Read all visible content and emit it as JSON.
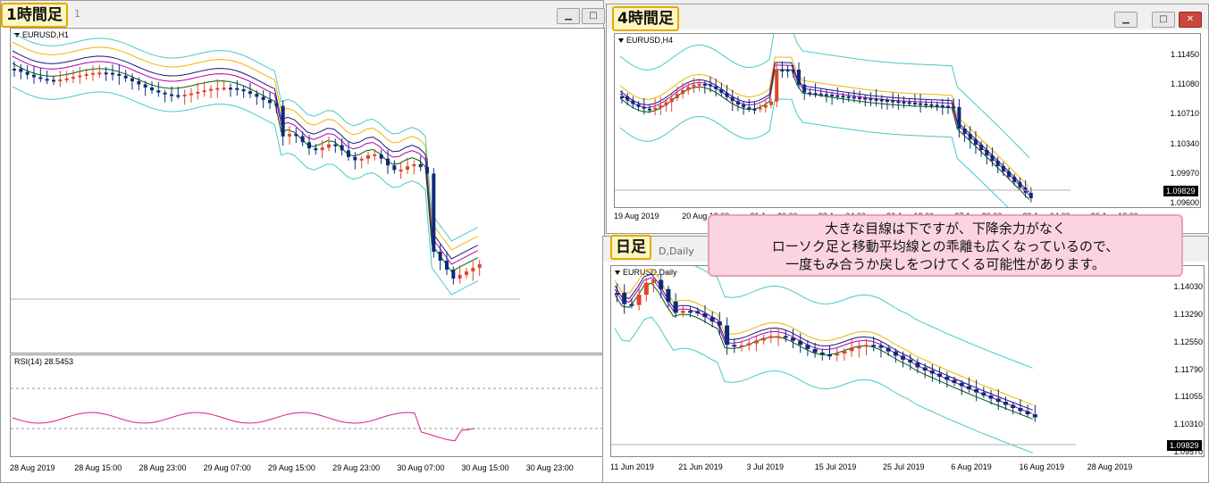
{
  "windows": {
    "h1": {
      "label": "1時間足",
      "chart_title": "EURUSD,H1",
      "title_suffix": "1",
      "sub_title": "RSI(14) 28.5453",
      "x_labels": [
        "28 Aug 2019",
        "28 Aug 15:00",
        "28 Aug 23:00",
        "29 Aug 07:00",
        "29 Aug 15:00",
        "29 Aug 23:00",
        "30 Aug 07:00",
        "30 Aug 15:00",
        "30 Aug 23:00"
      ]
    },
    "h4": {
      "label": "4時間足",
      "chart_title": "EURUSD,H4",
      "price_tag": "1.09829",
      "y_labels": [
        "1.11450",
        "1.11080",
        "1.10710",
        "1.10340",
        "1.09970",
        "1.09600"
      ],
      "x_labels": [
        "19 Aug 2019",
        "20 Aug 12:00",
        "21 Aug 20:00",
        "23 Aug 04:00",
        "26 Aug 12:00",
        "27 Aug 20:00",
        "29 Aug 04:00",
        "30 Aug 12:00"
      ]
    },
    "daily": {
      "label": "日足",
      "chart_title": "EURUSD,Daily",
      "title_partial": "D,Daily",
      "price_tag": "1.09829",
      "y_labels": [
        "1.14030",
        "1.13290",
        "1.12550",
        "1.11790",
        "1.11055",
        "1.10310",
        "1.09570"
      ],
      "x_labels": [
        "11 Jun 2019",
        "21 Jun 2019",
        "3 Jul 2019",
        "15 Jul 2019",
        "25 Jul 2019",
        "6 Aug 2019",
        "16 Aug 2019",
        "28 Aug 2019"
      ]
    }
  },
  "callout": {
    "line1": "大きな目線は下ですが、下降余力がなく",
    "line2": "ローソク足と移動平均線との乖離も広くなっているので、",
    "line3": "一度もみ合うか戻しをつけてくる可能性があります。"
  },
  "colors": {
    "bull": "#e0452b",
    "bear": "#0d2a7a",
    "label_bg": "#fff6c2",
    "label_border": "#e6a800",
    "callout_bg": "#fbd4e0"
  }
}
